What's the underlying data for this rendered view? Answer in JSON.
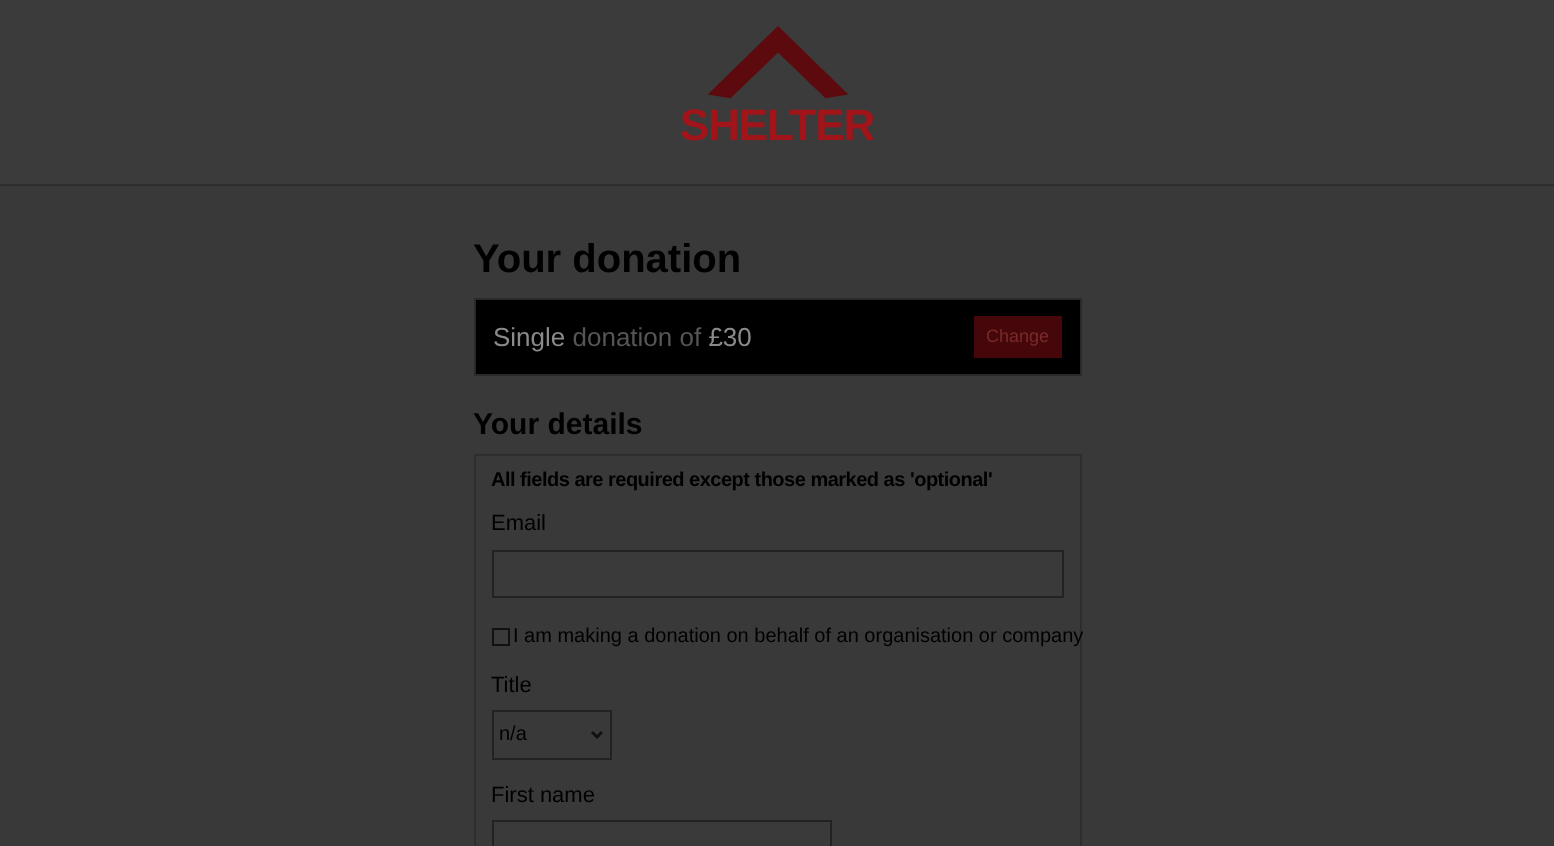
{
  "logo": {
    "text": "SHELTER"
  },
  "donation": {
    "heading": "Your donation",
    "frequency": "Single",
    "middle": "donation of",
    "amount": "£30",
    "button": "Change"
  },
  "details": {
    "heading": "Your details",
    "note": "All fields are required except those marked as 'optional'",
    "email": {
      "label": "Email"
    },
    "organisation": {
      "label": "I am making a donation on behalf of an organisation or company",
      "checked": false
    },
    "title": {
      "label": "Title",
      "value": "n/a"
    },
    "first_name": {
      "label": "First name"
    }
  }
}
